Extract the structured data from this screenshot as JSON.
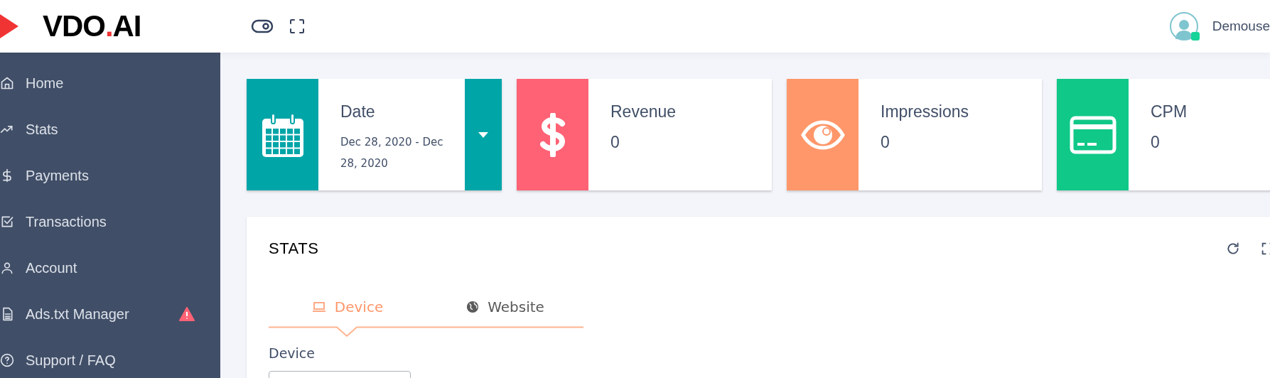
{
  "header": {
    "logo": {
      "prefix": "VDO",
      "dot": ".",
      "suffix": "AI"
    },
    "user": {
      "name": "Demouse",
      "online": true
    }
  },
  "sidebar": {
    "items": [
      {
        "label": "Home",
        "kind": "home",
        "alert": false
      },
      {
        "label": "Stats",
        "kind": "stats",
        "alert": false
      },
      {
        "label": "Payments",
        "kind": "payments",
        "alert": false
      },
      {
        "label": "Transactions",
        "kind": "transactions",
        "alert": false
      },
      {
        "label": "Account",
        "kind": "account",
        "alert": false
      },
      {
        "label": "Ads.txt Manager",
        "kind": "file",
        "alert": true
      },
      {
        "label": "Support / FAQ",
        "kind": "help",
        "alert": false
      }
    ]
  },
  "cards": [
    {
      "kind": "date",
      "title": "Date",
      "value": "Dec 28, 2020 - Dec 28, 2020",
      "color": "#00a5a8"
    },
    {
      "kind": "revenue",
      "title": "Revenue",
      "value": "0",
      "color": "#ff6275"
    },
    {
      "kind": "impressions",
      "title": "Impressions",
      "value": "0",
      "color": "#ff976a"
    },
    {
      "kind": "cpm",
      "title": "CPM",
      "value": "0",
      "color": "#10c888"
    }
  ],
  "stats_panel": {
    "title": "STATS",
    "tabs": [
      {
        "label": "Device",
        "kind": "laptop",
        "selected": true
      },
      {
        "label": "Website",
        "kind": "globe",
        "selected": false
      }
    ],
    "field_label": "Device"
  }
}
